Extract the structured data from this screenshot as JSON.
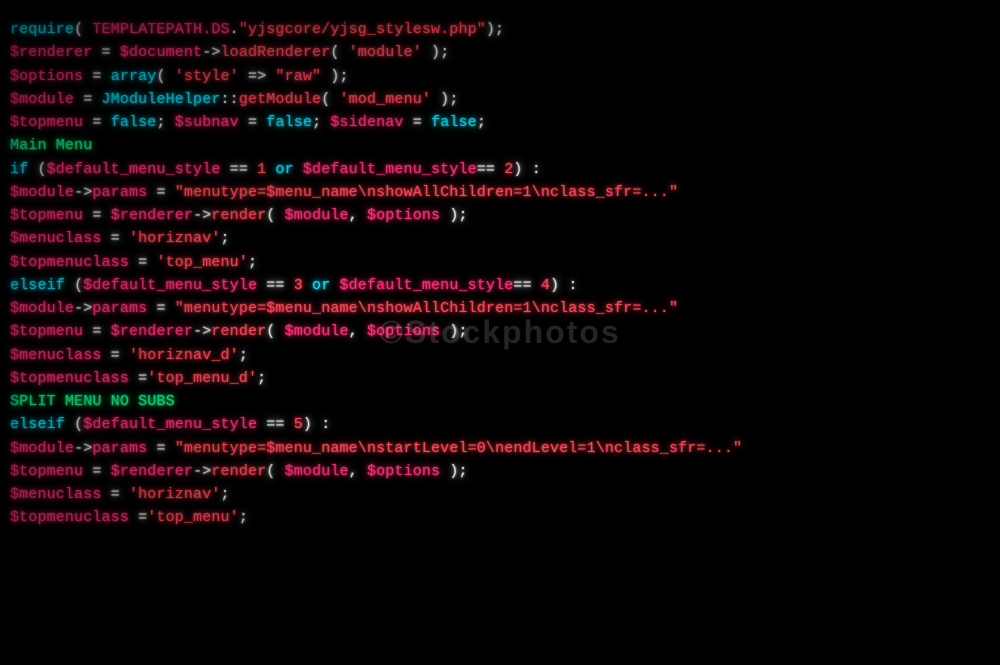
{
  "code": {
    "lines": [
      {
        "id": "l1",
        "parts": [
          {
            "text": "require",
            "color": "cyan"
          },
          {
            "text": "( ",
            "color": "white"
          },
          {
            "text": "TEMPLATEPATH.DS",
            "color": "pink"
          },
          {
            "text": ".",
            "color": "white"
          },
          {
            "text": "\"yjsgcore/yjsg_stylesw.php\"",
            "color": "red"
          },
          {
            "text": ");",
            "color": "white"
          }
        ]
      },
      {
        "id": "l2",
        "parts": [
          {
            "text": "$renderer",
            "color": "pink"
          },
          {
            "text": "   = ",
            "color": "white"
          },
          {
            "text": "$document",
            "color": "pink"
          },
          {
            "text": "->",
            "color": "white"
          },
          {
            "text": "loadRenderer",
            "color": "red"
          },
          {
            "text": "( ",
            "color": "white"
          },
          {
            "text": "'module'",
            "color": "red"
          },
          {
            "text": " );",
            "color": "white"
          }
        ]
      },
      {
        "id": "l3",
        "parts": [
          {
            "text": "$options",
            "color": "pink"
          },
          {
            "text": "    = ",
            "color": "white"
          },
          {
            "text": "array",
            "color": "cyan"
          },
          {
            "text": "( ",
            "color": "white"
          },
          {
            "text": "'style'",
            "color": "red"
          },
          {
            "text": " => ",
            "color": "white"
          },
          {
            "text": "\"raw\"",
            "color": "red"
          },
          {
            "text": " );",
            "color": "white"
          }
        ]
      },
      {
        "id": "l4",
        "parts": [
          {
            "text": "$module",
            "color": "pink"
          },
          {
            "text": "    = ",
            "color": "white"
          },
          {
            "text": "JModuleHelper",
            "color": "cyan"
          },
          {
            "text": "::",
            "color": "white"
          },
          {
            "text": "getModule",
            "color": "red"
          },
          {
            "text": "( ",
            "color": "white"
          },
          {
            "text": "'mod_menu'",
            "color": "red"
          },
          {
            "text": " );",
            "color": "white"
          }
        ]
      },
      {
        "id": "l5",
        "parts": [
          {
            "text": "$topmenu",
            "color": "pink"
          },
          {
            "text": "   = ",
            "color": "white"
          },
          {
            "text": "false",
            "color": "cyan"
          },
          {
            "text": "; ",
            "color": "white"
          },
          {
            "text": "$subnav",
            "color": "pink"
          },
          {
            "text": " = ",
            "color": "white"
          },
          {
            "text": "false",
            "color": "cyan"
          },
          {
            "text": "; ",
            "color": "white"
          },
          {
            "text": "$sidenav",
            "color": "pink"
          },
          {
            "text": " = ",
            "color": "white"
          },
          {
            "text": "false",
            "color": "cyan"
          },
          {
            "text": ";",
            "color": "white"
          }
        ]
      },
      {
        "id": "l6",
        "parts": [
          {
            "text": "Main Menu",
            "color": "green"
          }
        ]
      },
      {
        "id": "l7",
        "parts": [
          {
            "text": " if",
            "color": "cyan"
          },
          {
            "text": " (",
            "color": "white"
          },
          {
            "text": "$default_menu_style",
            "color": "pink"
          },
          {
            "text": " == ",
            "color": "white"
          },
          {
            "text": "1",
            "color": "red"
          },
          {
            "text": " or ",
            "color": "cyan"
          },
          {
            "text": "$default_menu_style",
            "color": "pink"
          },
          {
            "text": "== ",
            "color": "white"
          },
          {
            "text": "2",
            "color": "red"
          },
          {
            "text": ") :",
            "color": "white"
          }
        ]
      },
      {
        "id": "l8",
        "parts": [
          {
            "text": "        $module",
            "color": "pink"
          },
          {
            "text": "->",
            "color": "white"
          },
          {
            "text": "params",
            "color": "pink"
          },
          {
            "text": " = ",
            "color": "white"
          },
          {
            "text": "\"menutype=$menu_name\\nshowAllChildren=1\\nclass_sfr=...\"",
            "color": "red"
          }
        ]
      },
      {
        "id": "l9",
        "parts": [
          {
            "text": "        $topmenu",
            "color": "pink"
          },
          {
            "text": " = ",
            "color": "white"
          },
          {
            "text": "$renderer",
            "color": "pink"
          },
          {
            "text": "->",
            "color": "white"
          },
          {
            "text": "render",
            "color": "red"
          },
          {
            "text": "( ",
            "color": "white"
          },
          {
            "text": "$module",
            "color": "pink"
          },
          {
            "text": ", ",
            "color": "white"
          },
          {
            "text": "$options",
            "color": "pink"
          },
          {
            "text": " );",
            "color": "white"
          }
        ]
      },
      {
        "id": "l10",
        "parts": [
          {
            "text": "        $menuclass",
            "color": "pink"
          },
          {
            "text": " = ",
            "color": "white"
          },
          {
            "text": "'horiznav'",
            "color": "red"
          },
          {
            "text": ";",
            "color": "white"
          }
        ]
      },
      {
        "id": "l11",
        "parts": [
          {
            "text": "        $topmenuclass",
            "color": "pink"
          },
          {
            "text": " = ",
            "color": "white"
          },
          {
            "text": "'top_menu'",
            "color": "red"
          },
          {
            "text": ";",
            "color": "white"
          }
        ]
      },
      {
        "id": "l12",
        "parts": [
          {
            "text": " elseif",
            "color": "cyan"
          },
          {
            "text": " (",
            "color": "white"
          },
          {
            "text": "$default_menu_style",
            "color": "pink"
          },
          {
            "text": " == ",
            "color": "white"
          },
          {
            "text": "3",
            "color": "red"
          },
          {
            "text": " or ",
            "color": "cyan"
          },
          {
            "text": "$default_menu_style",
            "color": "pink"
          },
          {
            "text": "== ",
            "color": "white"
          },
          {
            "text": "4",
            "color": "red"
          },
          {
            "text": ") :",
            "color": "white"
          }
        ]
      },
      {
        "id": "l13",
        "parts": [
          {
            "text": "        $module",
            "color": "pink"
          },
          {
            "text": "->",
            "color": "white"
          },
          {
            "text": "params",
            "color": "pink"
          },
          {
            "text": " = ",
            "color": "white"
          },
          {
            "text": "\"menutype=$menu_name\\nshowAllChildren=1\\nclass_sfr=...\"",
            "color": "red"
          }
        ]
      },
      {
        "id": "l14",
        "parts": [
          {
            "text": "        $topmenu",
            "color": "pink"
          },
          {
            "text": " = ",
            "color": "white"
          },
          {
            "text": "$renderer",
            "color": "pink"
          },
          {
            "text": "->",
            "color": "white"
          },
          {
            "text": "render",
            "color": "red"
          },
          {
            "text": "( ",
            "color": "white"
          },
          {
            "text": "$module",
            "color": "pink"
          },
          {
            "text": ", ",
            "color": "white"
          },
          {
            "text": "$options",
            "color": "pink"
          },
          {
            "text": " );",
            "color": "white"
          }
        ]
      },
      {
        "id": "l15",
        "parts": [
          {
            "text": "        $menuclass",
            "color": "pink"
          },
          {
            "text": " = ",
            "color": "white"
          },
          {
            "text": "'horiznav_d'",
            "color": "red"
          },
          {
            "text": ";",
            "color": "white"
          }
        ]
      },
      {
        "id": "l16",
        "parts": [
          {
            "text": "        $topmenuclass",
            "color": "pink"
          },
          {
            "text": " =",
            "color": "white"
          },
          {
            "text": "'top_menu_d'",
            "color": "red"
          },
          {
            "text": ";",
            "color": "white"
          }
        ]
      },
      {
        "id": "l17",
        "parts": [
          {
            "text": "SPLIT MENU",
            "color": "green"
          },
          {
            "text": "  ",
            "color": "white"
          },
          {
            "text": "NO SUBS",
            "color": "green"
          }
        ]
      },
      {
        "id": "l18",
        "parts": [
          {
            "text": " elseif",
            "color": "cyan"
          },
          {
            "text": " (",
            "color": "white"
          },
          {
            "text": "$default_menu_style",
            "color": "pink"
          },
          {
            "text": " == ",
            "color": "white"
          },
          {
            "text": "5",
            "color": "red"
          },
          {
            "text": ") :",
            "color": "white"
          }
        ]
      },
      {
        "id": "l19",
        "parts": [
          {
            "text": "        $module",
            "color": "pink"
          },
          {
            "text": "->",
            "color": "white"
          },
          {
            "text": "params",
            "color": "pink"
          },
          {
            "text": " = ",
            "color": "white"
          },
          {
            "text": "\"menutype=$menu_name\\nstartLevel=0\\nendLevel=1\\nclass_sfr=...\"",
            "color": "red"
          }
        ]
      },
      {
        "id": "l20",
        "parts": [
          {
            "text": "        $topmenu",
            "color": "pink"
          },
          {
            "text": " = ",
            "color": "white"
          },
          {
            "text": "$renderer",
            "color": "pink"
          },
          {
            "text": "->",
            "color": "white"
          },
          {
            "text": "render",
            "color": "red"
          },
          {
            "text": "( ",
            "color": "white"
          },
          {
            "text": "$module",
            "color": "pink"
          },
          {
            "text": ", ",
            "color": "white"
          },
          {
            "text": "$options",
            "color": "pink"
          },
          {
            "text": " );",
            "color": "white"
          }
        ]
      },
      {
        "id": "l21",
        "parts": [
          {
            "text": "        $menuclass",
            "color": "pink"
          },
          {
            "text": " = ",
            "color": "white"
          },
          {
            "text": "'horiznav'",
            "color": "red"
          },
          {
            "text": ";",
            "color": "white"
          }
        ]
      },
      {
        "id": "l22",
        "parts": [
          {
            "text": "        $topmenuclass",
            "color": "pink"
          },
          {
            "text": " =",
            "color": "white"
          },
          {
            "text": "'top_menu'",
            "color": "red"
          },
          {
            "text": ";",
            "color": "white"
          }
        ]
      }
    ],
    "watermark": "©Stockphotos"
  }
}
